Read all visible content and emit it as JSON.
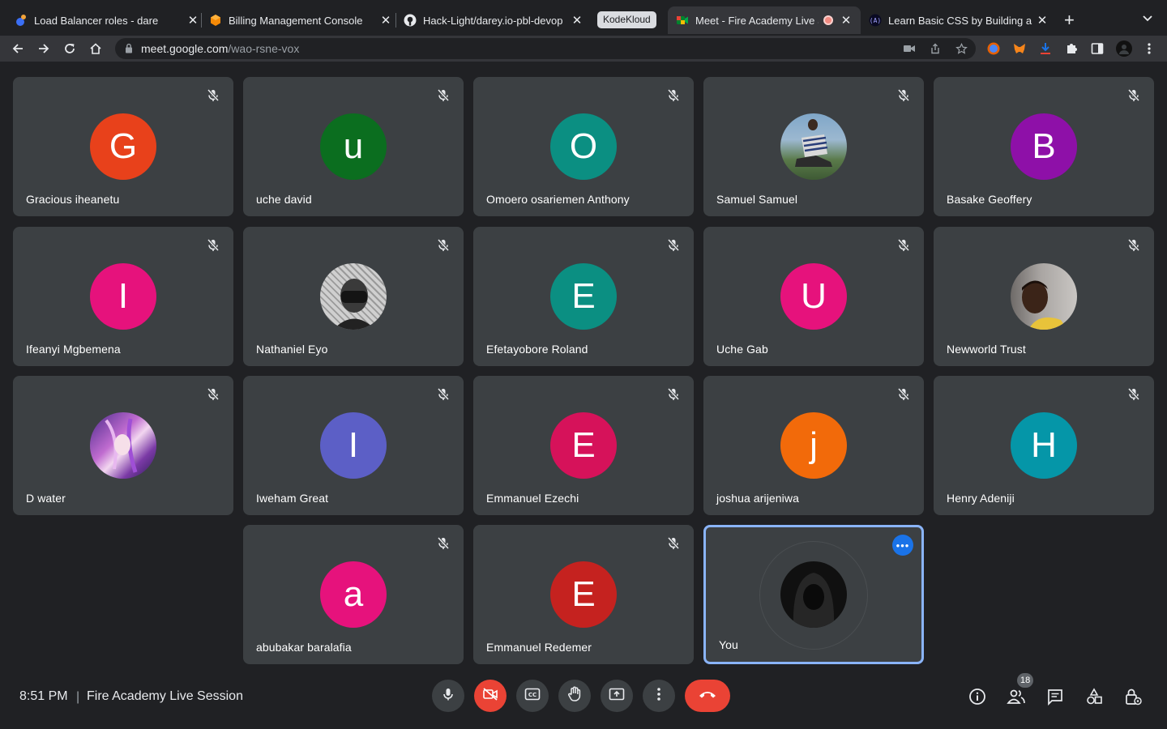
{
  "browser": {
    "tabs": [
      {
        "title": "Load Balancer roles - dare",
        "favicon": "darey-icon",
        "active": false
      },
      {
        "title": "Billing Management Console",
        "favicon": "aws-icon",
        "active": false
      },
      {
        "title": "Hack-Light/darey.io-pbl-devop",
        "favicon": "github-icon",
        "active": false
      },
      {
        "title": "Meet - Fire Academy Live S",
        "favicon": "meet-icon",
        "active": true,
        "recording_indicator": true
      },
      {
        "title": "Learn Basic CSS by Building a",
        "favicon": "freecodecamp-icon",
        "active": false
      }
    ],
    "tab_group_label": "KodeKloud",
    "url_host": "meet.google.com",
    "url_path": "/wao-rsne-vox"
  },
  "participants": [
    {
      "name": "Gracious iheanetu",
      "initial": "G",
      "color": "#e8411b",
      "muted": true
    },
    {
      "name": "uche david",
      "initial": "u",
      "color": "#0b6e1f",
      "muted": true
    },
    {
      "name": "Omoero osariemen Anthony",
      "initial": "O",
      "color": "#0b8f82",
      "muted": true
    },
    {
      "name": "Samuel Samuel",
      "photo": "photo-samuel",
      "muted": true
    },
    {
      "name": "Basake Geoffery",
      "initial": "B",
      "color": "#8e10a8",
      "muted": true
    },
    {
      "name": "Ifeanyi Mgbemena",
      "initial": "I",
      "color": "#e6127c",
      "muted": true
    },
    {
      "name": "Nathaniel Eyo",
      "photo": "photo-nathaniel",
      "muted": true
    },
    {
      "name": "Efetayobore Roland",
      "initial": "E",
      "color": "#0b8f82",
      "muted": true
    },
    {
      "name": "Uche Gab",
      "initial": "U",
      "color": "#e6127c",
      "muted": true
    },
    {
      "name": "Newworld Trust",
      "photo": "photo-newworld",
      "muted": true
    },
    {
      "name": "D water",
      "photo": "photo-dwater",
      "muted": true
    },
    {
      "name": "Iweham Great",
      "initial": "I",
      "color": "#5c5fc6",
      "muted": true
    },
    {
      "name": "Emmanuel Ezechi",
      "initial": "E",
      "color": "#d6125a",
      "muted": true
    },
    {
      "name": "joshua arijeniwa",
      "initial": "j",
      "color": "#f26a0a",
      "muted": true
    },
    {
      "name": "Henry Adeniji",
      "initial": "H",
      "color": "#0596a8",
      "muted": true
    },
    {
      "name": "abubakar baralafia",
      "initial": "a",
      "color": "#e6127c",
      "muted": true
    },
    {
      "name": "Emmanuel Redemer",
      "initial": "E",
      "color": "#c5221f",
      "muted": true
    }
  ],
  "self_tile": {
    "name": "You",
    "photo": "photo-self"
  },
  "bottom": {
    "time": "8:51 PM",
    "separator": "|",
    "meeting_title": "Fire Academy Live Session",
    "participant_count": "18",
    "controls": [
      "mic-icon",
      "camera-off-icon",
      "captions-icon",
      "raise-hand-icon",
      "present-icon",
      "more-options-icon",
      "hang-up-icon"
    ],
    "right_icons": [
      "info-icon",
      "people-icon",
      "chat-icon",
      "activities-icon",
      "host-controls-icon"
    ]
  },
  "colors": {
    "background": "#202124",
    "tile": "#3c4043",
    "accent": "#8ab4f8",
    "danger": "#ea4335"
  }
}
